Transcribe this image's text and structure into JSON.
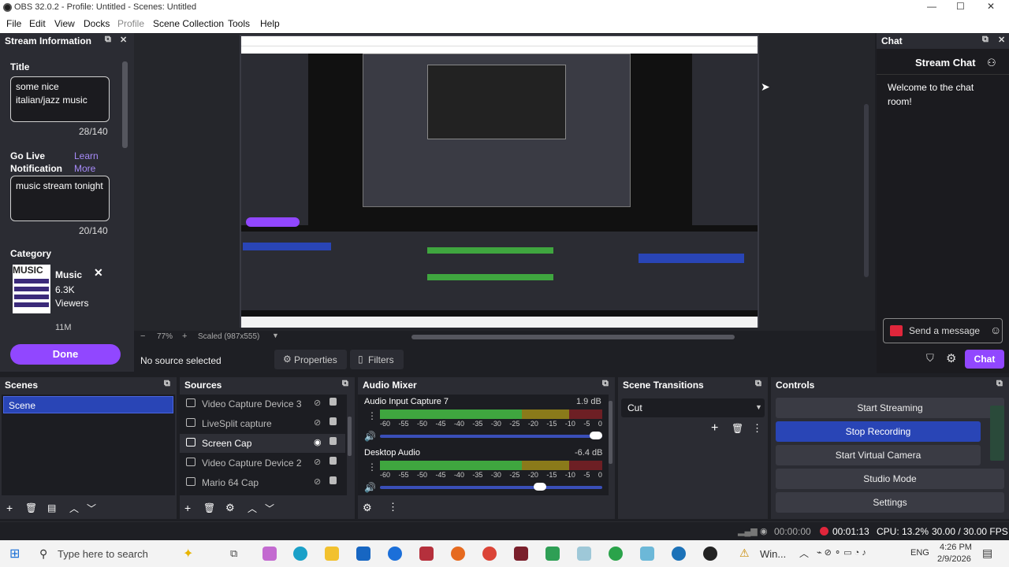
{
  "window": {
    "title": "OBS 32.0.2 - Profile: Untitled - Scenes: Untitled",
    "min": "—",
    "max": "☐",
    "close": "✕"
  },
  "menu": [
    "File",
    "Edit",
    "View",
    "Docks",
    "Profile",
    "Scene Collection",
    "Tools",
    "Help"
  ],
  "stream_info": {
    "header": "Stream Information",
    "title_label": "Title",
    "title_value": "some nice italian/jazz music",
    "title_count": "28/140",
    "golive_label": "Go Live Notification",
    "learn_more": "Learn More",
    "golive_value": "music stream tonight",
    "golive_count": "20/140",
    "category_label": "Category",
    "category_name": "Music",
    "category_viewers": "6.3K Viewers",
    "category_art": "MUSIC",
    "category_extra": "11M",
    "done": "Done"
  },
  "preview": {
    "zoom": "77%",
    "scale": "Scaled (987x555)",
    "minus": "−",
    "plus": "+"
  },
  "source_bar": {
    "no_source": "No source selected",
    "properties": "Properties",
    "filters": "Filters"
  },
  "chat": {
    "header": "Chat",
    "title": "Stream Chat",
    "welcome": "Welcome to the chat room!",
    "send_placeholder": "Send a message",
    "chat_button": "Chat"
  },
  "scenes": {
    "header": "Scenes",
    "items": [
      "Scene"
    ]
  },
  "sources": {
    "header": "Sources",
    "items": [
      {
        "name": "Video Capture Device 3",
        "icon": "camera-icon"
      },
      {
        "name": "LiveSplit capture",
        "icon": "window-icon"
      },
      {
        "name": "Screen Cap",
        "icon": "monitor-icon"
      },
      {
        "name": "Video Capture Device 2",
        "icon": "camera-icon"
      },
      {
        "name": "Mario 64 Cap",
        "icon": "gamepad-icon"
      }
    ]
  },
  "audio": {
    "header": "Audio Mixer",
    "channels": [
      {
        "name": "Audio Input Capture 7",
        "db": "1.9 dB",
        "volume": 0.97
      },
      {
        "name": "Desktop Audio",
        "db": "-6.4 dB",
        "volume": 0.72
      }
    ],
    "ticks": [
      "-60",
      "-55",
      "-50",
      "-45",
      "-40",
      "-35",
      "-30",
      "-25",
      "-20",
      "-15",
      "-10",
      "-5",
      "0"
    ]
  },
  "transitions": {
    "header": "Scene Transitions",
    "selected": "Cut"
  },
  "controls": {
    "header": "Controls",
    "buttons": [
      "Start Streaming",
      "Stop Recording",
      "Start Virtual Camera",
      "Studio Mode",
      "Settings"
    ]
  },
  "status": {
    "stream_time": "00:00:00",
    "rec_time": "00:01:13",
    "cpu": "CPU: 13.2%",
    "fps": "30.00 / 30.00 FPS"
  },
  "taskbar": {
    "search": "Type here to search",
    "weather": "Win...",
    "lang": "ENG",
    "time": "4:26 PM",
    "date": "2/9/2026"
  },
  "colors": {
    "accent": "#9147ff",
    "selected": "#2945b6",
    "bg": "#1e1f24"
  }
}
